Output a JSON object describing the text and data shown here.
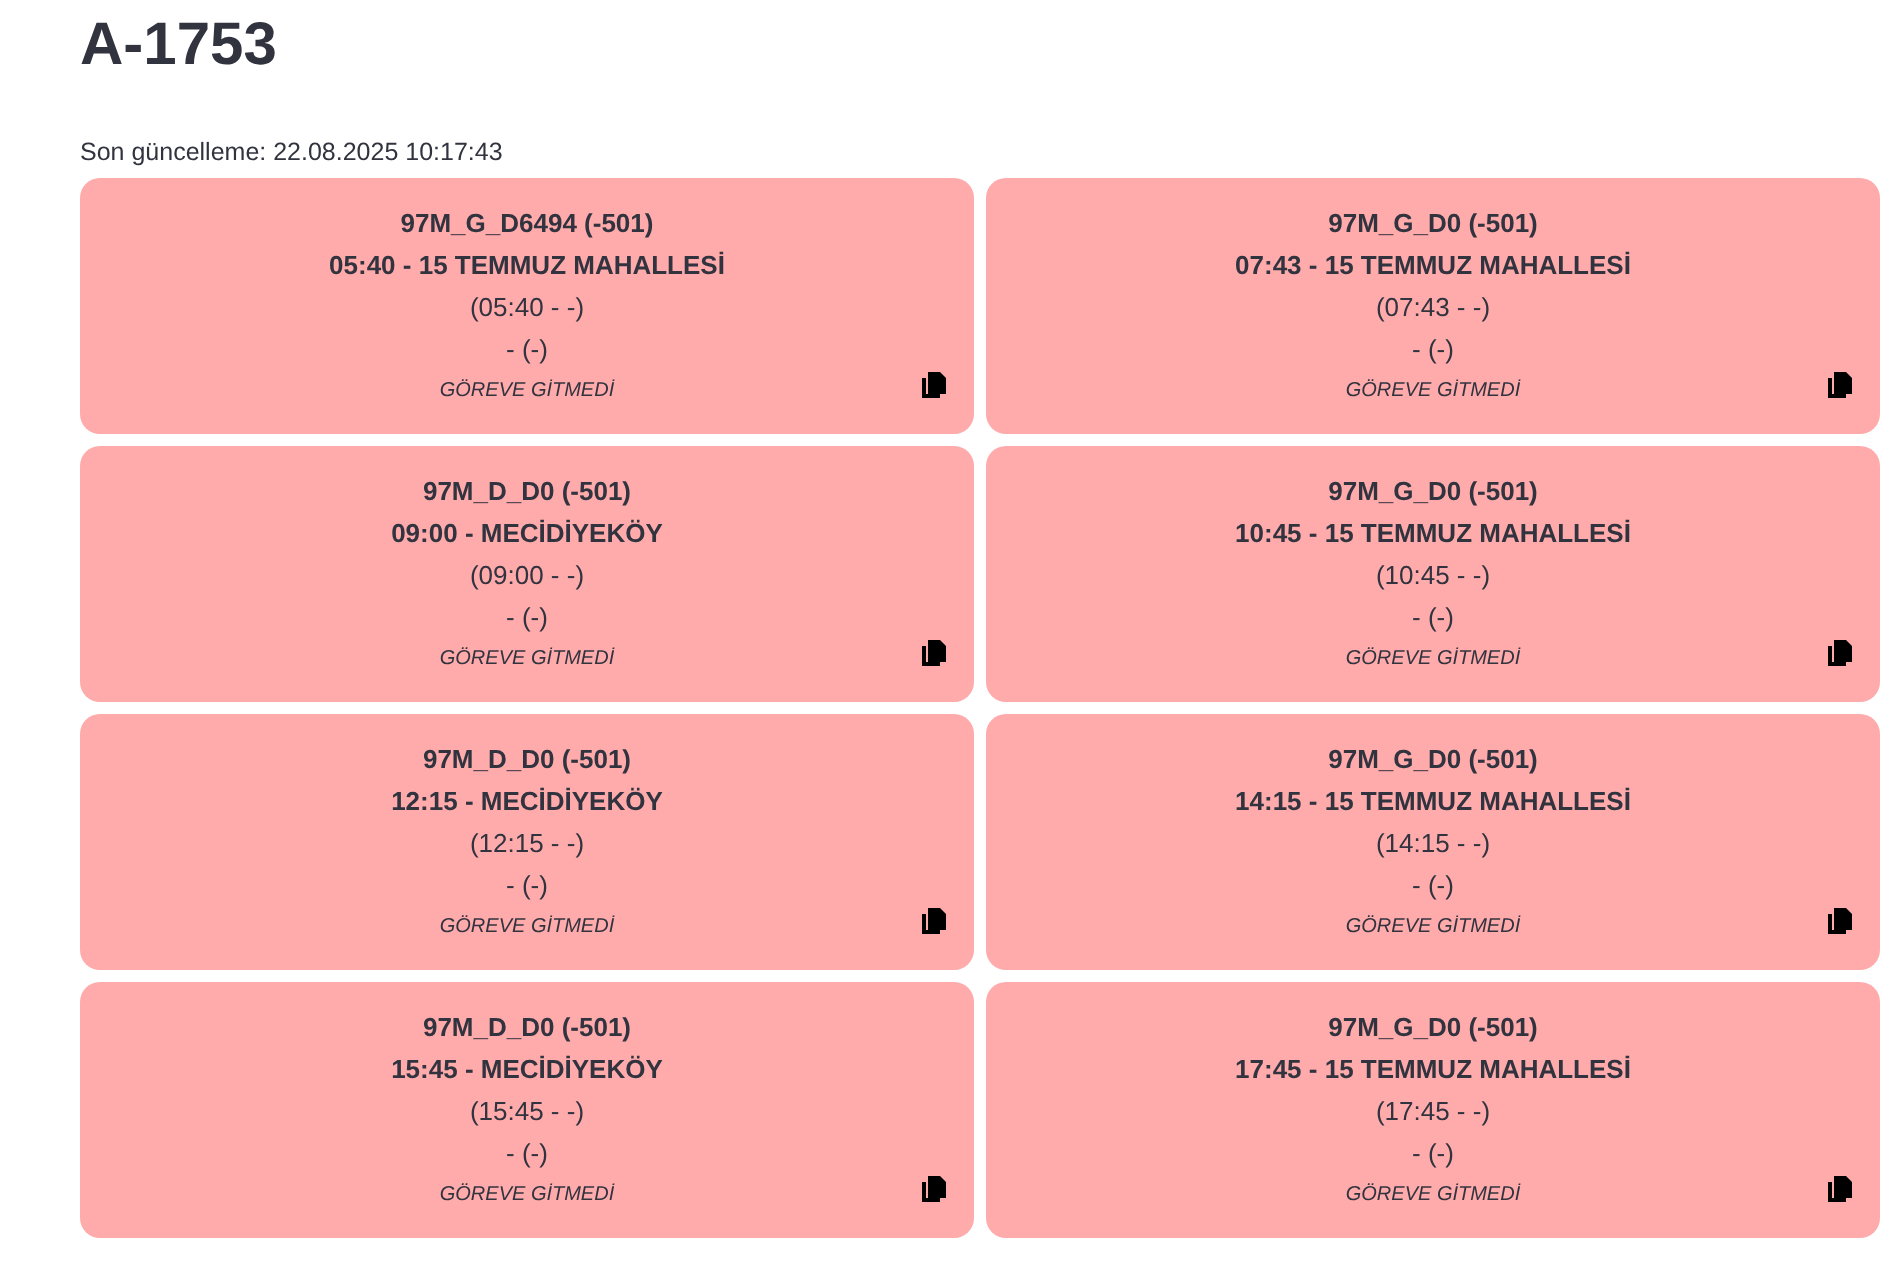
{
  "title": "A-1753",
  "last_updated": "Son güncelleme: 22.08.2025 10:17:43",
  "cards": [
    {
      "code": "97M_G_D6494 (-501)",
      "departure": "05:40 - 15 TEMMUZ MAHALLESİ",
      "times": "(05:40 - -)",
      "actual": "- (-)",
      "status": "GÖREVE GİTMEDİ"
    },
    {
      "code": "97M_G_D0 (-501)",
      "departure": "07:43 - 15 TEMMUZ MAHALLESİ",
      "times": "(07:43 - -)",
      "actual": "- (-)",
      "status": "GÖREVE GİTMEDİ"
    },
    {
      "code": "97M_D_D0 (-501)",
      "departure": "09:00 - MECİDİYEKÖY",
      "times": "(09:00 - -)",
      "actual": "- (-)",
      "status": "GÖREVE GİTMEDİ"
    },
    {
      "code": "97M_G_D0 (-501)",
      "departure": "10:45 - 15 TEMMUZ MAHALLESİ",
      "times": "(10:45 - -)",
      "actual": "- (-)",
      "status": "GÖREVE GİTMEDİ"
    },
    {
      "code": "97M_D_D0 (-501)",
      "departure": "12:15 - MECİDİYEKÖY",
      "times": "(12:15 - -)",
      "actual": "- (-)",
      "status": "GÖREVE GİTMEDİ"
    },
    {
      "code": "97M_G_D0 (-501)",
      "departure": "14:15 - 15 TEMMUZ MAHALLESİ",
      "times": "(14:15 - -)",
      "actual": "- (-)",
      "status": "GÖREVE GİTMEDİ"
    },
    {
      "code": "97M_D_D0 (-501)",
      "departure": "15:45 - MECİDİYEKÖY",
      "times": "(15:45 - -)",
      "actual": "- (-)",
      "status": "GÖREVE GİTMEDİ"
    },
    {
      "code": "97M_G_D0 (-501)",
      "departure": "17:45 - 15 TEMMUZ MAHALLESİ",
      "times": "(17:45 - -)",
      "actual": "- (-)",
      "status": "GÖREVE GİTMEDİ"
    }
  ]
}
